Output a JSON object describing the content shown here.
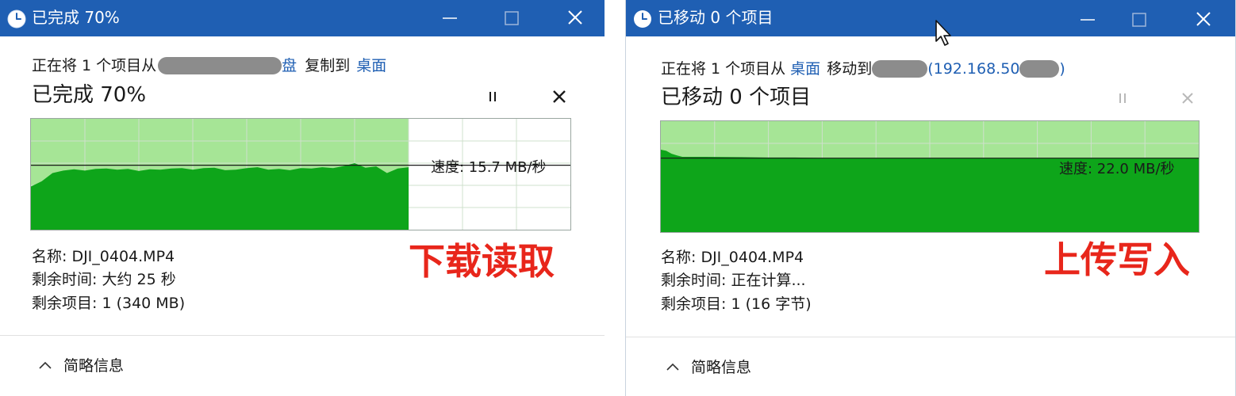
{
  "colors": {
    "titlebar": "#1f5fb3",
    "link": "#1f5fb3",
    "chart_fill": "#0ea51a",
    "chart_progress": "#a6e596",
    "overlay": "#e8261b"
  },
  "icons": {
    "window": "clock-icon",
    "minimize": "minimize-icon",
    "maximize": "maximize-icon",
    "close": "close-icon",
    "pause": "pause-icon",
    "cancel": "cancel-icon",
    "toggle": "chevron-up-icon",
    "cursor": "mouse-pointer-icon"
  },
  "copy_dialog": {
    "title": "已完成 70%",
    "op_prefix": "正在将 1 个项目从",
    "source_tail": "盘",
    "op_mid": "复制到",
    "dest": "桌面",
    "status": "已完成 70%",
    "speed": "速度: 15.7 MB/秒",
    "name": "名称: DJI_0404.MP4",
    "time_left": "剩余时间: 大约 25 秒",
    "items_left": "剩余项目: 1 (340 MB)",
    "overlay_label": "下载读取",
    "toggle_label": "简略信息"
  },
  "move_dialog": {
    "title": "已移动 0 个项目",
    "op_prefix": "正在将 1 个项目从",
    "source": "桌面",
    "op_mid": "移动到",
    "dest_ip": "(192.168.50",
    "dest_tail": ")",
    "status": "已移动 0 个项目",
    "speed": "速度: 22.0 MB/秒",
    "name": "名称: DJI_0404.MP4",
    "time_left": "剩余时间: 正在计算...",
    "items_left": "剩余项目: 1 (16 字节)",
    "overlay_label": "上传写入",
    "toggle_label": "简略信息"
  },
  "chart_data": [
    {
      "type": "area",
      "progress": 0.7,
      "current_speed": 15.7,
      "ylim": [
        0,
        27
      ],
      "x": [
        0.0,
        0.02,
        0.04,
        0.06,
        0.08,
        0.1,
        0.12,
        0.14,
        0.16,
        0.18,
        0.2,
        0.22,
        0.24,
        0.26,
        0.28,
        0.3,
        0.32,
        0.34,
        0.36,
        0.38,
        0.4,
        0.42,
        0.44,
        0.46,
        0.48,
        0.5,
        0.52,
        0.54,
        0.56,
        0.58,
        0.6,
        0.62,
        0.64,
        0.66,
        0.68,
        0.7
      ],
      "y": [
        10.5,
        11.8,
        13.8,
        14.4,
        14.7,
        14.4,
        14.8,
        14.9,
        14.6,
        14.8,
        14.3,
        14.7,
        14.6,
        14.9,
        15.0,
        14.6,
        15.0,
        15.1,
        14.5,
        14.6,
        15.0,
        15.2,
        14.6,
        14.8,
        14.5,
        15.0,
        14.9,
        15.2,
        15.0,
        15.5,
        16.2,
        15.1,
        15.4,
        13.8,
        14.9,
        15.2
      ]
    },
    {
      "type": "area",
      "progress": 1.0,
      "current_speed": 22.0,
      "ylim": [
        0,
        33
      ],
      "x": [
        0.0,
        0.01,
        0.02,
        0.03,
        0.04,
        0.08,
        0.15,
        0.2,
        0.25,
        0.3,
        0.4,
        0.5,
        0.6,
        0.7,
        0.8,
        0.9,
        1.0
      ],
      "y": [
        24.5,
        24.2,
        23.3,
        22.8,
        22.4,
        22.4,
        22.3,
        22.2,
        22.2,
        22.0,
        22.0,
        22.0,
        22.0,
        22.0,
        22.0,
        22.0,
        22.0
      ]
    }
  ]
}
